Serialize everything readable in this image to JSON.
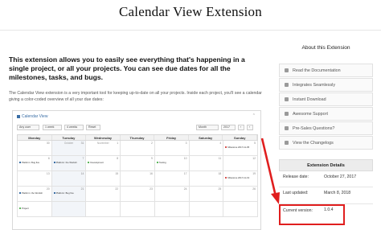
{
  "page": {
    "title": "Calendar View Extension"
  },
  "intro": {
    "lead": "This extension allows you to easily see everything that's happening in a single project, or all your projects. You can see due dates for all the milestones, tasks, and bugs.",
    "description": "The Calendar View extension is a very important tool for keeping up-to-date on all your projects. Inside each project, you'll see a calendar giving a color-coded overview of all your due dates:"
  },
  "calendar_screenshot": {
    "title": "Calendar View",
    "toolbar": {
      "view": "Any user",
      "period": "1 week",
      "length": "4 weeks",
      "reset": "Reset",
      "month_select": "Month",
      "year_select": "2017"
    },
    "weekdays": [
      "Monday",
      "Tuesday",
      "Wednesday",
      "Thursday",
      "Friday",
      "Saturday",
      "Sunday"
    ],
    "month_labels": {
      "october": "October",
      "november": "November"
    },
    "day_numbers": [
      "30",
      "31",
      "1",
      "2",
      "3",
      "4",
      "5",
      "6",
      "7",
      "8",
      "9",
      "10",
      "11",
      "12",
      "13",
      "14",
      "15",
      "16",
      "17",
      "18",
      "19",
      "20",
      "21",
      "22",
      "23",
      "24",
      "25",
      "26"
    ],
    "events": {
      "e1": "Milestone 2017-11-05",
      "e2": "Platform: Bug fixe",
      "e3": "Platform: the Worksh",
      "e4": "Development",
      "e5": "Testing",
      "e6": "Milestone 2017-11-19",
      "e7": "Platform: the Worksh",
      "e8": "Platform: Bug fixe",
      "e9": "Project"
    },
    "colors": {
      "accent": "#3a6ea5",
      "milestone": "#d9534f",
      "task": "#5cb85c"
    }
  },
  "sidebar": {
    "title": "About this Extension",
    "items": [
      {
        "label": "Read the Documentation",
        "icon": "book-icon"
      },
      {
        "label": "Integrates Seamlessly",
        "icon": "puzzle-icon"
      },
      {
        "label": "Instant Download",
        "icon": "download-icon"
      },
      {
        "label": "Awesome Support",
        "icon": "life-ring-icon"
      },
      {
        "label": "Pre-Sales Questions?",
        "icon": "question-icon"
      },
      {
        "label": "View the Changelogs",
        "icon": "list-icon"
      }
    ]
  },
  "details": {
    "title": "Extension Details",
    "release_label": "Release date:",
    "release_value": "October 27, 2017",
    "updated_label": "Last updated:",
    "updated_value": "March 8, 2018",
    "version_label": "Current version:",
    "version_value": "1.0.4"
  },
  "annotation": {
    "arrow_color": "#e01e1e"
  }
}
